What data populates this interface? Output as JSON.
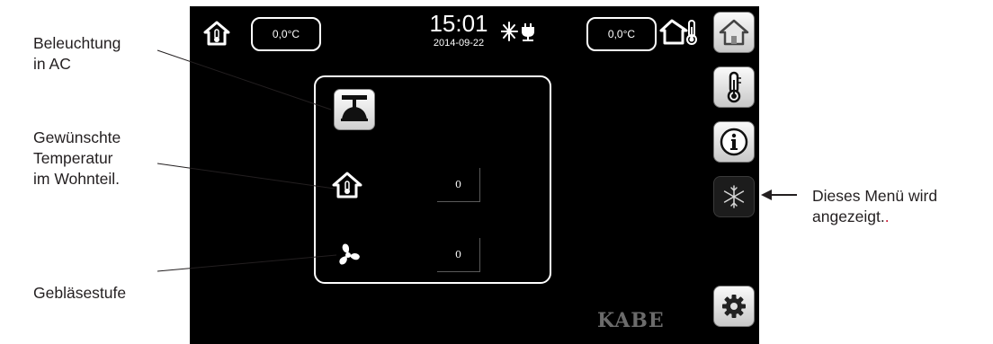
{
  "callouts": {
    "lighting": [
      "Beleuchtung",
      "in AC"
    ],
    "temperature": [
      "Gewünschte",
      "Temperatur",
      "im Wohnteil."
    ],
    "fan": [
      "Gebläsestufe"
    ],
    "menu": {
      "line1": "Dieses Menü wird",
      "line2": "angezeigt.",
      "line2_suffix": "."
    }
  },
  "header": {
    "inside_temp": "0,0°C",
    "time": "15:01",
    "date": "2014-09-22",
    "outside_temp": "0,0°C"
  },
  "panel": {
    "temperature_value": "0",
    "fan_value": "0"
  },
  "sidebar": {
    "items": [
      {
        "icon": "home-icon",
        "active": false
      },
      {
        "icon": "thermometer-icon",
        "active": false
      },
      {
        "icon": "info-icon",
        "active": false
      },
      {
        "icon": "snowflake-icon",
        "active": true
      },
      {
        "icon": "gear-icon",
        "active": false
      }
    ]
  },
  "brand": "KABE",
  "colors": {
    "screen_bg": "#000000",
    "accent_red": "#c8102e",
    "button_light": "#eeeeee"
  }
}
